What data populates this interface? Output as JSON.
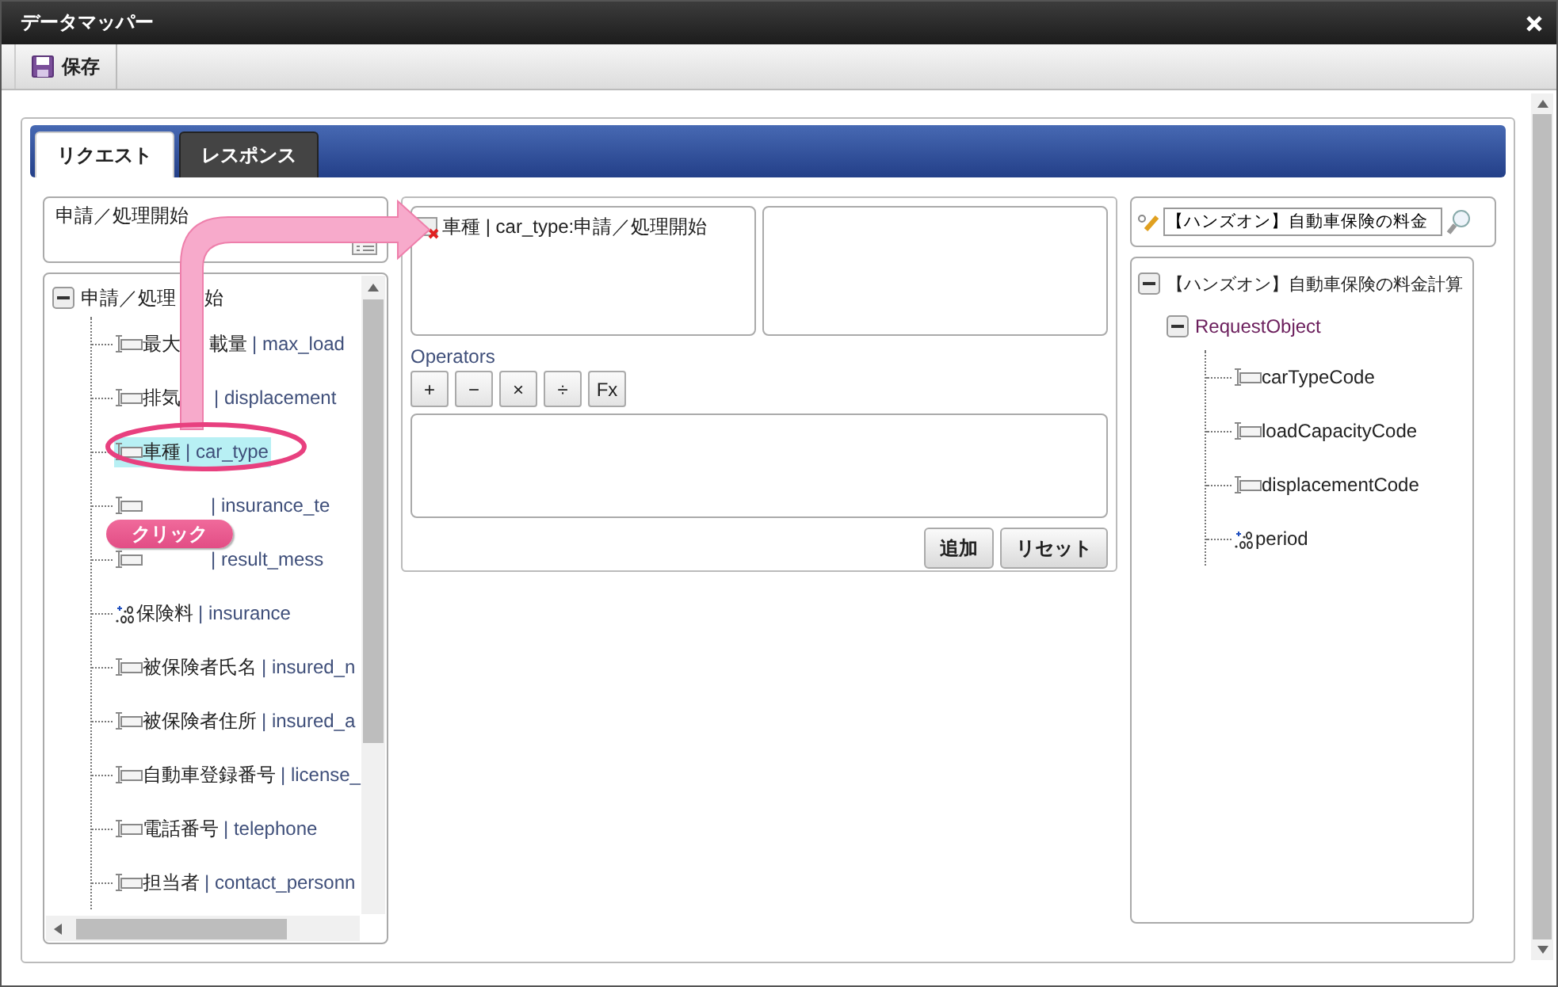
{
  "window": {
    "title": "データマッパー"
  },
  "toolbar": {
    "buttons": [
      {
        "label": "保存"
      }
    ]
  },
  "tabs": [
    {
      "label": "リクエスト",
      "selected": true
    },
    {
      "label": "レスポンス",
      "selected": false
    }
  ],
  "source": {
    "selector_value": "申請／処理開始",
    "tree": {
      "label": [
        "申請／処理",
        "始"
      ],
      "expanded": true,
      "children": [
        {
          "name": [
            "最大",
            "載量"
          ],
          "field": "| max_load",
          "kind": "text",
          "selected": false
        },
        {
          "name": [
            "排気"
          ],
          "gap_after_name": true,
          "field": "| displacement",
          "kind": "text",
          "selected": false
        },
        {
          "name": [
            "車種"
          ],
          "field": "| car_type",
          "kind": "text",
          "selected": true
        },
        {
          "field": "| insurance_te",
          "kind": "text",
          "selected": false
        },
        {
          "field": "| result_mess",
          "kind": "text",
          "selected": false
        },
        {
          "name": [
            "保険料"
          ],
          "field": "| insurance",
          "kind": "number",
          "selected": false
        },
        {
          "name": [
            "被保険者氏名"
          ],
          "field": "| insured_n",
          "kind": "text",
          "selected": false
        },
        {
          "name": [
            "被保険者住所"
          ],
          "field": "| insured_a",
          "kind": "text",
          "selected": false
        },
        {
          "name": [
            "自動車登録番号"
          ],
          "field": "| license_",
          "kind": "text",
          "selected": false
        },
        {
          "name": [
            "電話番号"
          ],
          "field": "| telephone",
          "kind": "text",
          "selected": false
        },
        {
          "name": [
            "担当者"
          ],
          "field": "| contact_personn",
          "kind": "text",
          "selected": false
        }
      ]
    }
  },
  "mapping": {
    "source_items": [
      {
        "text": "車種 | car_type:申請／処理開始"
      }
    ],
    "operators_label": "Operators",
    "operators": [
      "+",
      "−",
      "×",
      "÷",
      "Fx"
    ],
    "buttons": [
      "追加",
      "リセット"
    ]
  },
  "target": {
    "search_value": "【ハンズオン】自動車保険の料金",
    "tree": {
      "label": "【ハンズオン】自動車保険の料金計算",
      "expanded": true,
      "children": [
        {
          "label": "RequestObject",
          "expanded": true,
          "children": [
            {
              "label": "carTypeCode",
              "kind": "text"
            },
            {
              "label": "loadCapacityCode",
              "kind": "text"
            },
            {
              "label": "displacementCode",
              "kind": "text"
            },
            {
              "label": "period",
              "kind": "number"
            }
          ]
        }
      ]
    }
  },
  "annotation": {
    "callout": "クリック"
  }
}
